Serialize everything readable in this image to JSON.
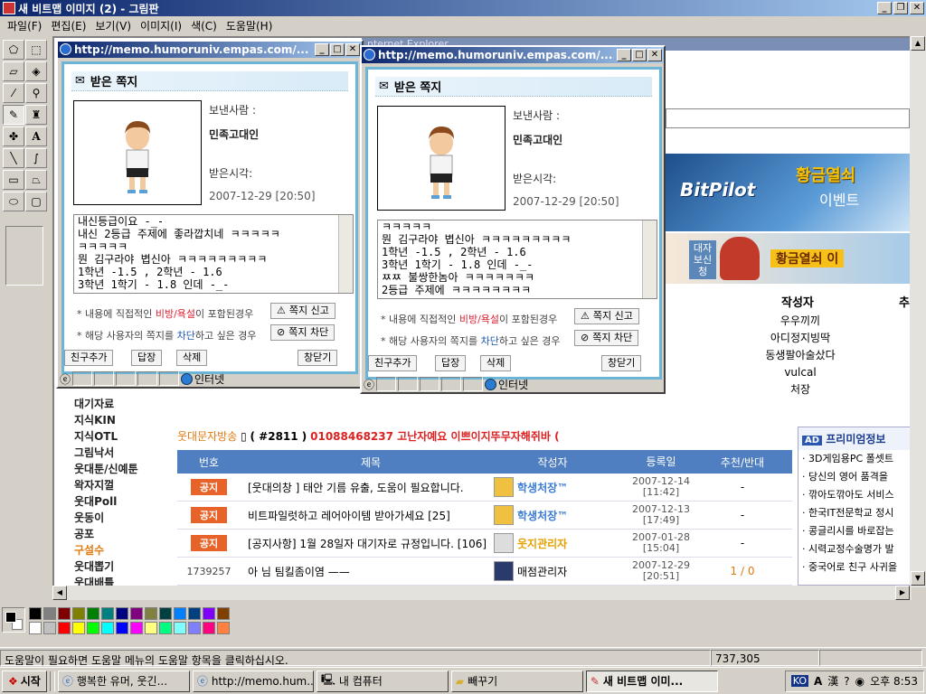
{
  "paint": {
    "title": "새 비트맵 이미지 (2) - 그림판",
    "menu": [
      "파일(F)",
      "편집(E)",
      "보기(V)",
      "이미지(I)",
      "색(C)",
      "도움말(H)"
    ],
    "status_help": "도움말이 필요하면 도움말 메뉴의 도움말 항목을 클릭하십시오.",
    "coords": "737,305",
    "palette_top": [
      "#000000",
      "#808080",
      "#800000",
      "#808000",
      "#008000",
      "#008080",
      "#000080",
      "#800080",
      "#808040",
      "#004040",
      "#0080ff",
      "#004080",
      "#8000ff",
      "#804000"
    ],
    "palette_bottom": [
      "#ffffff",
      "#c0c0c0",
      "#ff0000",
      "#ffff00",
      "#00ff00",
      "#00ffff",
      "#0000ff",
      "#ff00ff",
      "#ffff80",
      "#00ff80",
      "#80ffff",
      "#8080ff",
      "#ff0080",
      "#ff8040"
    ]
  },
  "web": {
    "left_nav": [
      "대기자료",
      "지식KIN",
      "지식OTL",
      "그림낙서",
      "웃대툰/신예툰",
      "왁자지껄",
      "웃대Poll",
      "웃동이",
      "공포",
      "구설수",
      "웃대뽑기",
      "웃대배틀"
    ],
    "ranking_header": "작성자",
    "ranking_header2": "추",
    "ranking": [
      "우우끼끼",
      "아디정지빙딱",
      "동생팔아술샀다",
      "vulcal",
      "처장"
    ],
    "sms_label": "웃대문자방송",
    "sms_number": "( #2811 )",
    "sms_text": "01088468237 고난자예요 이쁘이지뚜무자해쥐바 (",
    "table_headers": [
      "번호",
      "제목",
      "작성자",
      "등록일",
      "추천/반대"
    ],
    "rows": [
      {
        "num": "공지",
        "title": "[웃대의창 ] 태안 기름 유출, 도움이 필요합니다.",
        "author": "학생처장™",
        "date": "2007-12-14",
        "time": "[11:42]",
        "vote": "-"
      },
      {
        "num": "공지",
        "title": "비트파일럿하고 레어아이템 받아가세요 [25]",
        "author": "학생처장™",
        "date": "2007-12-13",
        "time": "[17:49]",
        "vote": "-"
      },
      {
        "num": "공지",
        "title": "[공지사항] 1월 28일자 대기자로 규정입니다. [106]",
        "author": "웃지관리자",
        "date": "2007-01-28",
        "time": "[15:04]",
        "vote": "-"
      },
      {
        "num": "1739257",
        "title": "아 님 팀킬좀이염 ——",
        "author": "매점관리자",
        "date": "2007-12-29",
        "time": "[20:51]",
        "vote": "1 / 0"
      }
    ],
    "ad_header": "프리미엄정보",
    "ad_badge": "AD",
    "ads": [
      "3D게임용PC 폴셋트",
      "당신의 영어 품격을",
      "깎아도깎아도 서비스",
      "한국IT전문학교 정시",
      "콩글리시를 바로잡는",
      "시력교정수술명가 발",
      "중국어로 친구 사귀을"
    ],
    "banner_title": "황금열쇠",
    "banner_sub": "이벤트",
    "banner_brand": "BitPilot",
    "banner2_left": "대자보신청",
    "banner2_text": "황금열쇠 이",
    "bg_window_title": "nternet Explorer"
  },
  "popup_common": {
    "title": "http://memo.humoruniv.empas.com/...",
    "header": "받은 쪽지",
    "sender_label": "보낸사람 :",
    "sender": "민족고대인",
    "time_label": "받은시각:",
    "time": "2007-12-29 [20:50]",
    "note1_pre": "* 내용에 직접적인 ",
    "note1_hl": "비방/욕설",
    "note1_post": "이 포함된경우",
    "note2_pre": "* 해당 사용자의 쪽지를 ",
    "note2_hl": "차단",
    "note2_post": "하고 싶은 경우",
    "report_btn": "쪽지 신고",
    "block_btn": "쪽지 차단",
    "add_friend": "친구추가",
    "reply": "답장",
    "delete": "삭제",
    "close": "창닫기",
    "status_zone": "인터넷"
  },
  "popup1_lines": [
    "내신등급이요 -_-",
    "내신 2등급 주제에 좋라깝치네 ㅋㅋㅋㅋㅋ",
    "ㅋㅋㅋㅋㅋ",
    "뭔 김구라야 볍신아 ㅋㅋㅋㅋㅋㅋㅋㅋㅋ",
    "1학년 -1.5 , 2학년 - 1.6",
    "3학년 1학기 - 1.8 인데 -_-"
  ],
  "popup2_lines": [
    "ㅋㅋㅋㅋㅋ",
    "뭔 김구라야 볍신아 ㅋㅋㅋㅋㅋㅋㅋㅋㅋ",
    "1학년 -1.5 , 2학년 - 1.6",
    "3학년 1학기 - 1.8 인데 -_-",
    "ㅉㅉ 불쌍한놈아 ㅋㅋㅋㅋㅋㅋㅋ",
    "2등급 주제에 ㅋㅋㅋㅋㅋㅋㅋㅋ"
  ],
  "taskbar": {
    "start": "시작",
    "tasks": [
      "행복한 유머, 웃긴...",
      "http://memo.hum...",
      "내 컴퓨터",
      "빼꾸기",
      "새 비트맵 이미..."
    ],
    "tray_ime": "KO",
    "tray_a": "A",
    "tray_han": "漢",
    "clock": "오후 8:53"
  }
}
